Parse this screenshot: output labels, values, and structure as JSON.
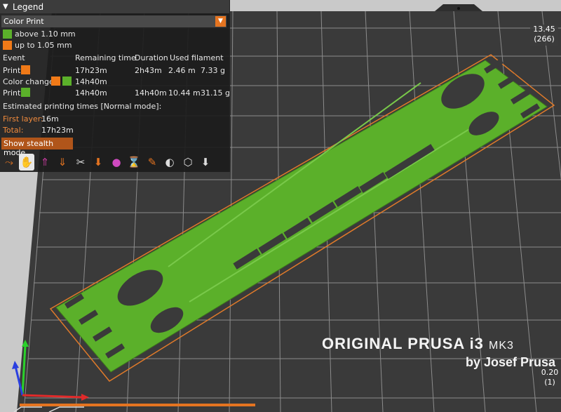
{
  "legend": {
    "title": "Legend",
    "view_type": "Color Print",
    "items": [
      {
        "label": "above 1.10 mm",
        "color": "#5bb02a"
      },
      {
        "label": "up to 1.05 mm",
        "color": "#f07a18"
      }
    ],
    "columns": {
      "event": "Event",
      "remaining": "Remaining time",
      "duration": "Duration",
      "filament": "Used filament"
    },
    "rows": [
      {
        "event": "Print",
        "remaining": "17h23m",
        "duration": "2h43m",
        "length": "2.46 m",
        "weight": "7.33 g"
      },
      {
        "event": "Color change",
        "remaining": "14h40m"
      },
      {
        "event": "Print",
        "remaining": "14h40m",
        "duration": "14h40m",
        "length": "10.44 m",
        "weight": "31.15 g"
      }
    ],
    "estimated_header": "Estimated printing times [Normal mode]:",
    "first_layer_label": "First layer:",
    "first_layer_value": "16m",
    "total_label": "Total:",
    "total_value": "17h23m",
    "stealth_button": "Show stealth mode"
  },
  "toolbar_icons": [
    "travel-icon",
    "wipe-icon",
    "retractions-icon",
    "deretractions-icon",
    "seams-icon",
    "tool-changes-icon",
    "color-changes-icon",
    "pause-icon",
    "custom-gcode-icon",
    "center-of-gravity-icon",
    "shells-icon",
    "tool-marker-icon"
  ],
  "vertical_slider": {
    "top_value": "13.45",
    "top_layer": "(266)",
    "bottom_value": "0.20",
    "bottom_layer": "(1)"
  },
  "bed": {
    "name": "ORIGINAL PRUSA i3",
    "model": "MK3",
    "by": "by Josef Prusa"
  },
  "colors": {
    "bed": "#3a3a3a",
    "grid": "#8a8a8a",
    "part": "#5bb02a",
    "outline": "#e07a2a",
    "accent": "#e57420"
  }
}
